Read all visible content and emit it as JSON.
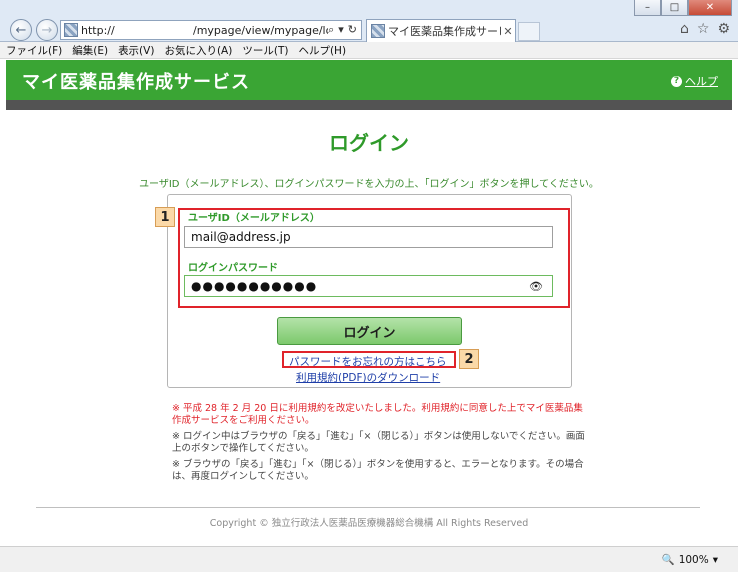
{
  "browser": {
    "url_host": "http://",
    "url_path": "/mypage/view/mypage/login.ht",
    "tab_title": "マイ医薬品集作成サービ...",
    "menu": [
      "ファイル(F)",
      "編集(E)",
      "表示(V)",
      "お気に入り(A)",
      "ツール(T)",
      "ヘルプ(H)"
    ],
    "zoom": "100%"
  },
  "header": {
    "site_title": "マイ医薬品集作成サービス",
    "help_label": "ヘルプ"
  },
  "login": {
    "title": "ログイン",
    "instruction": "ユーザID（メールアドレス）、ログインパスワードを入力の上、「ログイン」ボタンを押してください。",
    "user_label": "ユーザID（メールアドレス）",
    "user_value": "mail@address.jp",
    "password_label": "ログインパスワード",
    "password_value": "●●●●●●●●●●●",
    "login_button": "ログイン",
    "forgot_link": "パスワードをお忘れの方はこちら",
    "terms_link": "利用規約(PDF)のダウンロード"
  },
  "callouts": [
    "1",
    "2"
  ],
  "notes": [
    "※ 平成 28 年 2 月 20 日に利用規約を改定いたしました。利用規約に同意した上でマイ医薬品集作成サービスをご利用ください。",
    "※ ログイン中はブラウザの「戻る」「進む」「×（閉じる）」ボタンは使用しないでください。画面上のボタンで操作してください。",
    "※ ブラウザの「戻る」「進む」「×（閉じる）」ボタンを使用すると、エラーとなります。その場合は、再度ログインしてください。"
  ],
  "footer": {
    "copyright": "Copyright © 独立行政法人医薬品医療機器総合機構 All Rights Reserved"
  },
  "colors": {
    "brand_green": "#3aa534",
    "callout_red": "#e0232a",
    "link_blue": "#1f3fa8"
  }
}
